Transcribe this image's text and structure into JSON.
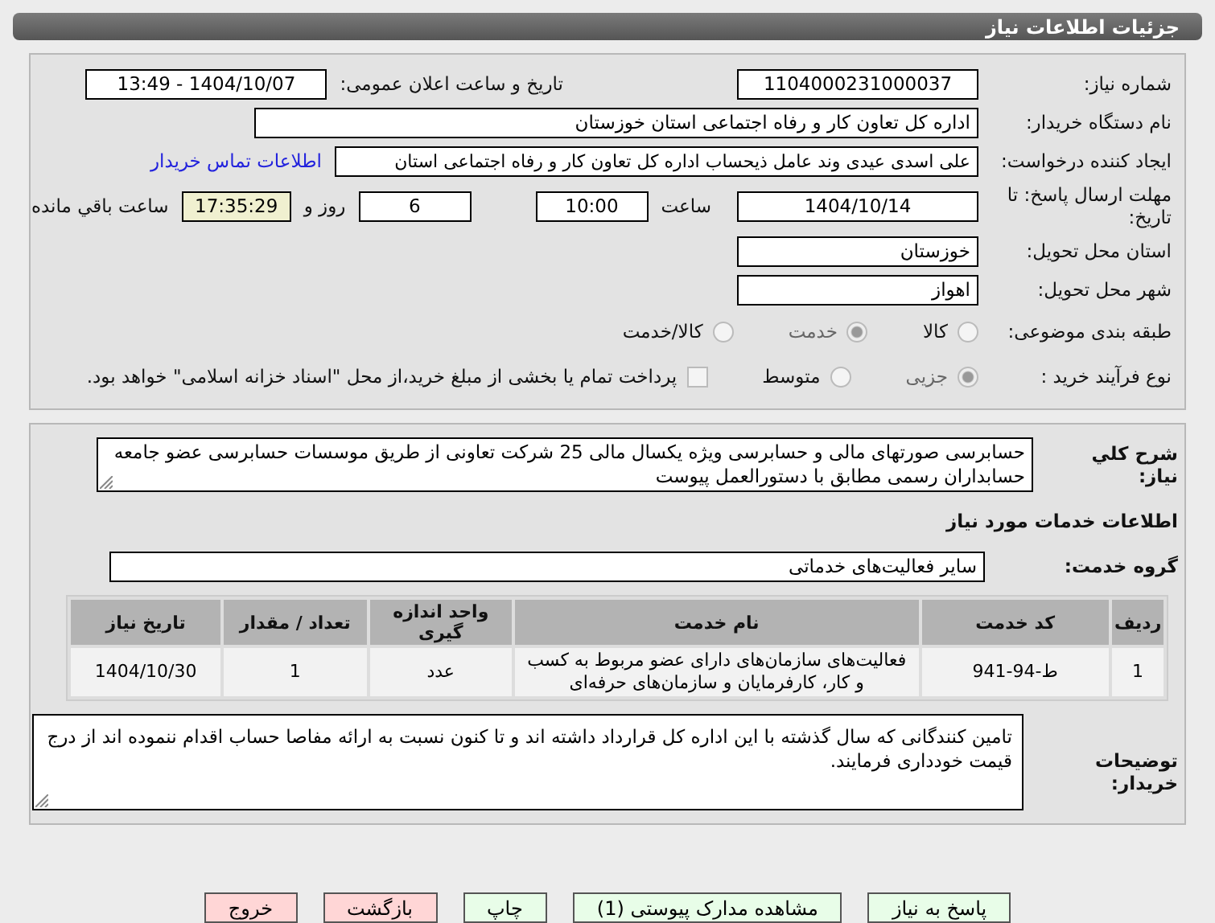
{
  "header": {
    "title": "جزئیات اطلاعات نیاز"
  },
  "need_number": {
    "label": "شماره نیاز:",
    "value": "1104000231000037"
  },
  "announce": {
    "label": "تاریخ و ساعت اعلان عمومی:",
    "value": "1404/10/07 - 13:49"
  },
  "buyer": {
    "label": "نام دستگاه خریدار:",
    "value": "اداره کل تعاون  کار و رفاه اجتماعی استان خوزستان"
  },
  "requester": {
    "label": "ایجاد کننده درخواست:",
    "value": "علی اسدی عیدی وند عامل ذیحساب اداره کل تعاون  کار و رفاه اجتماعی استان",
    "link": "اطلاعات تماس خریدار"
  },
  "deadline": {
    "label": "مهلت ارسال پاسخ: تا تاریخ:",
    "date": "1404/10/14",
    "time_label": "ساعت",
    "time": "10:00",
    "days": "6",
    "days_label": "روز و",
    "remaining": "17:35:29",
    "remaining_label": "ساعت باقي مانده"
  },
  "province": {
    "label": "استان محل تحویل:",
    "value": "خوزستان"
  },
  "city": {
    "label": "شهر محل تحویل:",
    "value": "اهواز"
  },
  "category": {
    "label": "طبقه بندی موضوعی:",
    "options": [
      {
        "label": "کالا",
        "selected": false
      },
      {
        "label": "خدمت",
        "selected": true
      },
      {
        "label": "کالا/خدمت",
        "selected": false
      }
    ]
  },
  "process": {
    "label": "نوع فرآیند خرید :",
    "options": [
      {
        "label": "جزیی",
        "selected": true
      },
      {
        "label": "متوسط",
        "selected": false
      }
    ],
    "treasury": {
      "checked": false,
      "label": "پرداخت تمام یا بخشی از مبلغ خرید،از محل \"اسناد خزانه اسلامی\" خواهد بود."
    }
  },
  "description": {
    "label": "شرح کلي نياز:",
    "value": "حسابرسی صورتهای مالی و حسابرسی ویژه یکسال مالی 25 شرکت تعاونی از طریق موسسات حسابرسی عضو جامعه حسابداران رسمی مطابق با دستورالعمل پیوست"
  },
  "services_title": "اطلاعات خدمات مورد نياز",
  "service_group": {
    "label": "گروه خدمت:",
    "value": "سایر فعالیت‌های خدماتی"
  },
  "table": {
    "columns": [
      "ردیف",
      "کد خدمت",
      "نام خدمت",
      "واحد اندازه گیری",
      "تعداد / مقدار",
      "تاریخ نیاز"
    ],
    "rows": [
      [
        "1",
        "ط-94-941",
        "فعالیت‌های سازمان‌های دارای عضو مربوط به کسب و کار، کارفرمایان و سازمان‌های حرفه‌ای",
        "عدد",
        "1",
        "1404/10/30"
      ]
    ]
  },
  "buyer_notes": {
    "label": "توضیحات خریدار:",
    "value": "تامین کنندگانی که سال گذشته با این اداره کل قرارداد داشته اند و تا کنون نسبت به ارائه مفاصا حساب اقدام ننموده اند از درج قیمت خودداری فرمایند."
  },
  "buttons": [
    {
      "label": "پاسخ به نیاز",
      "kind": "primary"
    },
    {
      "label": "مشاهده مدارک پیوستی (1)",
      "kind": "primary"
    },
    {
      "label": "چاپ",
      "kind": "primary"
    },
    {
      "label": "بازگشت",
      "kind": "danger"
    },
    {
      "label": "خروج",
      "kind": "danger"
    }
  ]
}
